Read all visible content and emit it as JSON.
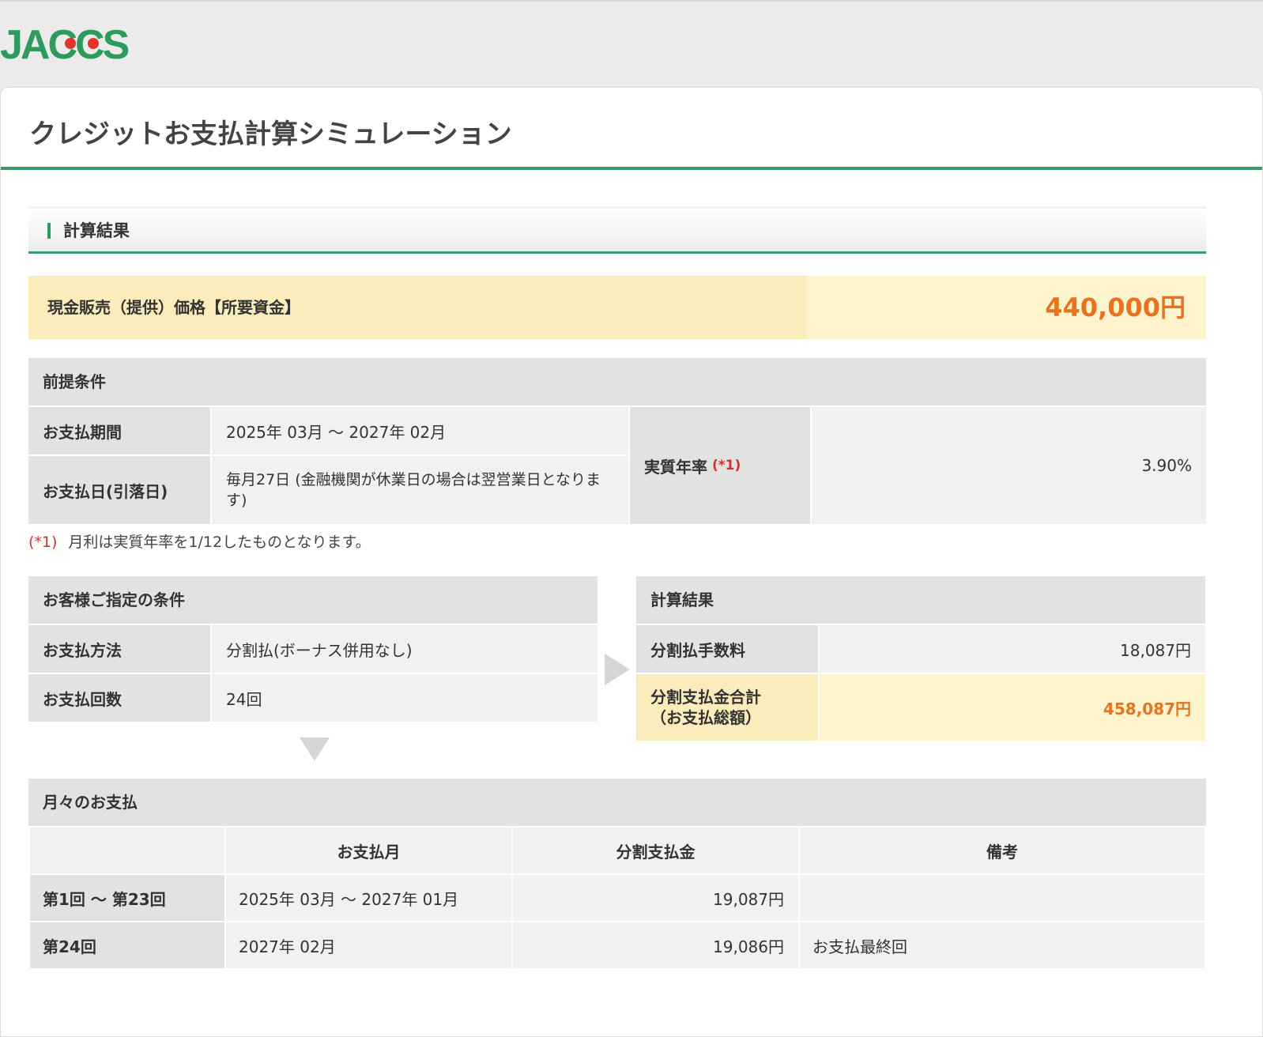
{
  "brand": {
    "logo_text": "JACCS",
    "color": "#2e9b5c"
  },
  "page": {
    "title": "クレジットお支払計算シミュレーション"
  },
  "section": {
    "title": "計算結果"
  },
  "price": {
    "label": "現金販売（提供）価格【所要資金】",
    "value": "440,000円"
  },
  "premise": {
    "header": "前提条件",
    "period_label": "お支払期間",
    "period_value": "2025年 03月 〜 2027年 02月",
    "payday_label": "お支払日(引落日)",
    "payday_value": "毎月27日 (金融機関が休業日の場合は翌営業日となります)",
    "rate_label": "実質年率",
    "rate_marker": "(*1)",
    "rate_value": "3.90%"
  },
  "note": {
    "marker": "(*1)",
    "text": "月利は実質年率を1/12したものとなります。"
  },
  "customer": {
    "header": "お客様ご指定の条件",
    "method_label": "お支払方法",
    "method_value": "分割払(ボーナス併用なし)",
    "count_label": "お支払回数",
    "count_value": "24回"
  },
  "result": {
    "header": "計算結果",
    "fee_label": "分割払手数料",
    "fee_value": "18,087円",
    "total_label_1": "分割支払金合計",
    "total_label_2": "（お支払総額）",
    "total_value": "458,087円"
  },
  "monthly": {
    "header": "月々のお支払",
    "columns": [
      "",
      "お支払月",
      "分割支払金",
      "備考"
    ],
    "rows": [
      {
        "label": "第1回 〜 第23回",
        "month": "2025年 03月 〜 2027年 01月",
        "amount": "19,087円",
        "note": ""
      },
      {
        "label": "第24回",
        "month": "2027年 02月",
        "amount": "19,086円",
        "note": "お支払最終回"
      }
    ]
  }
}
